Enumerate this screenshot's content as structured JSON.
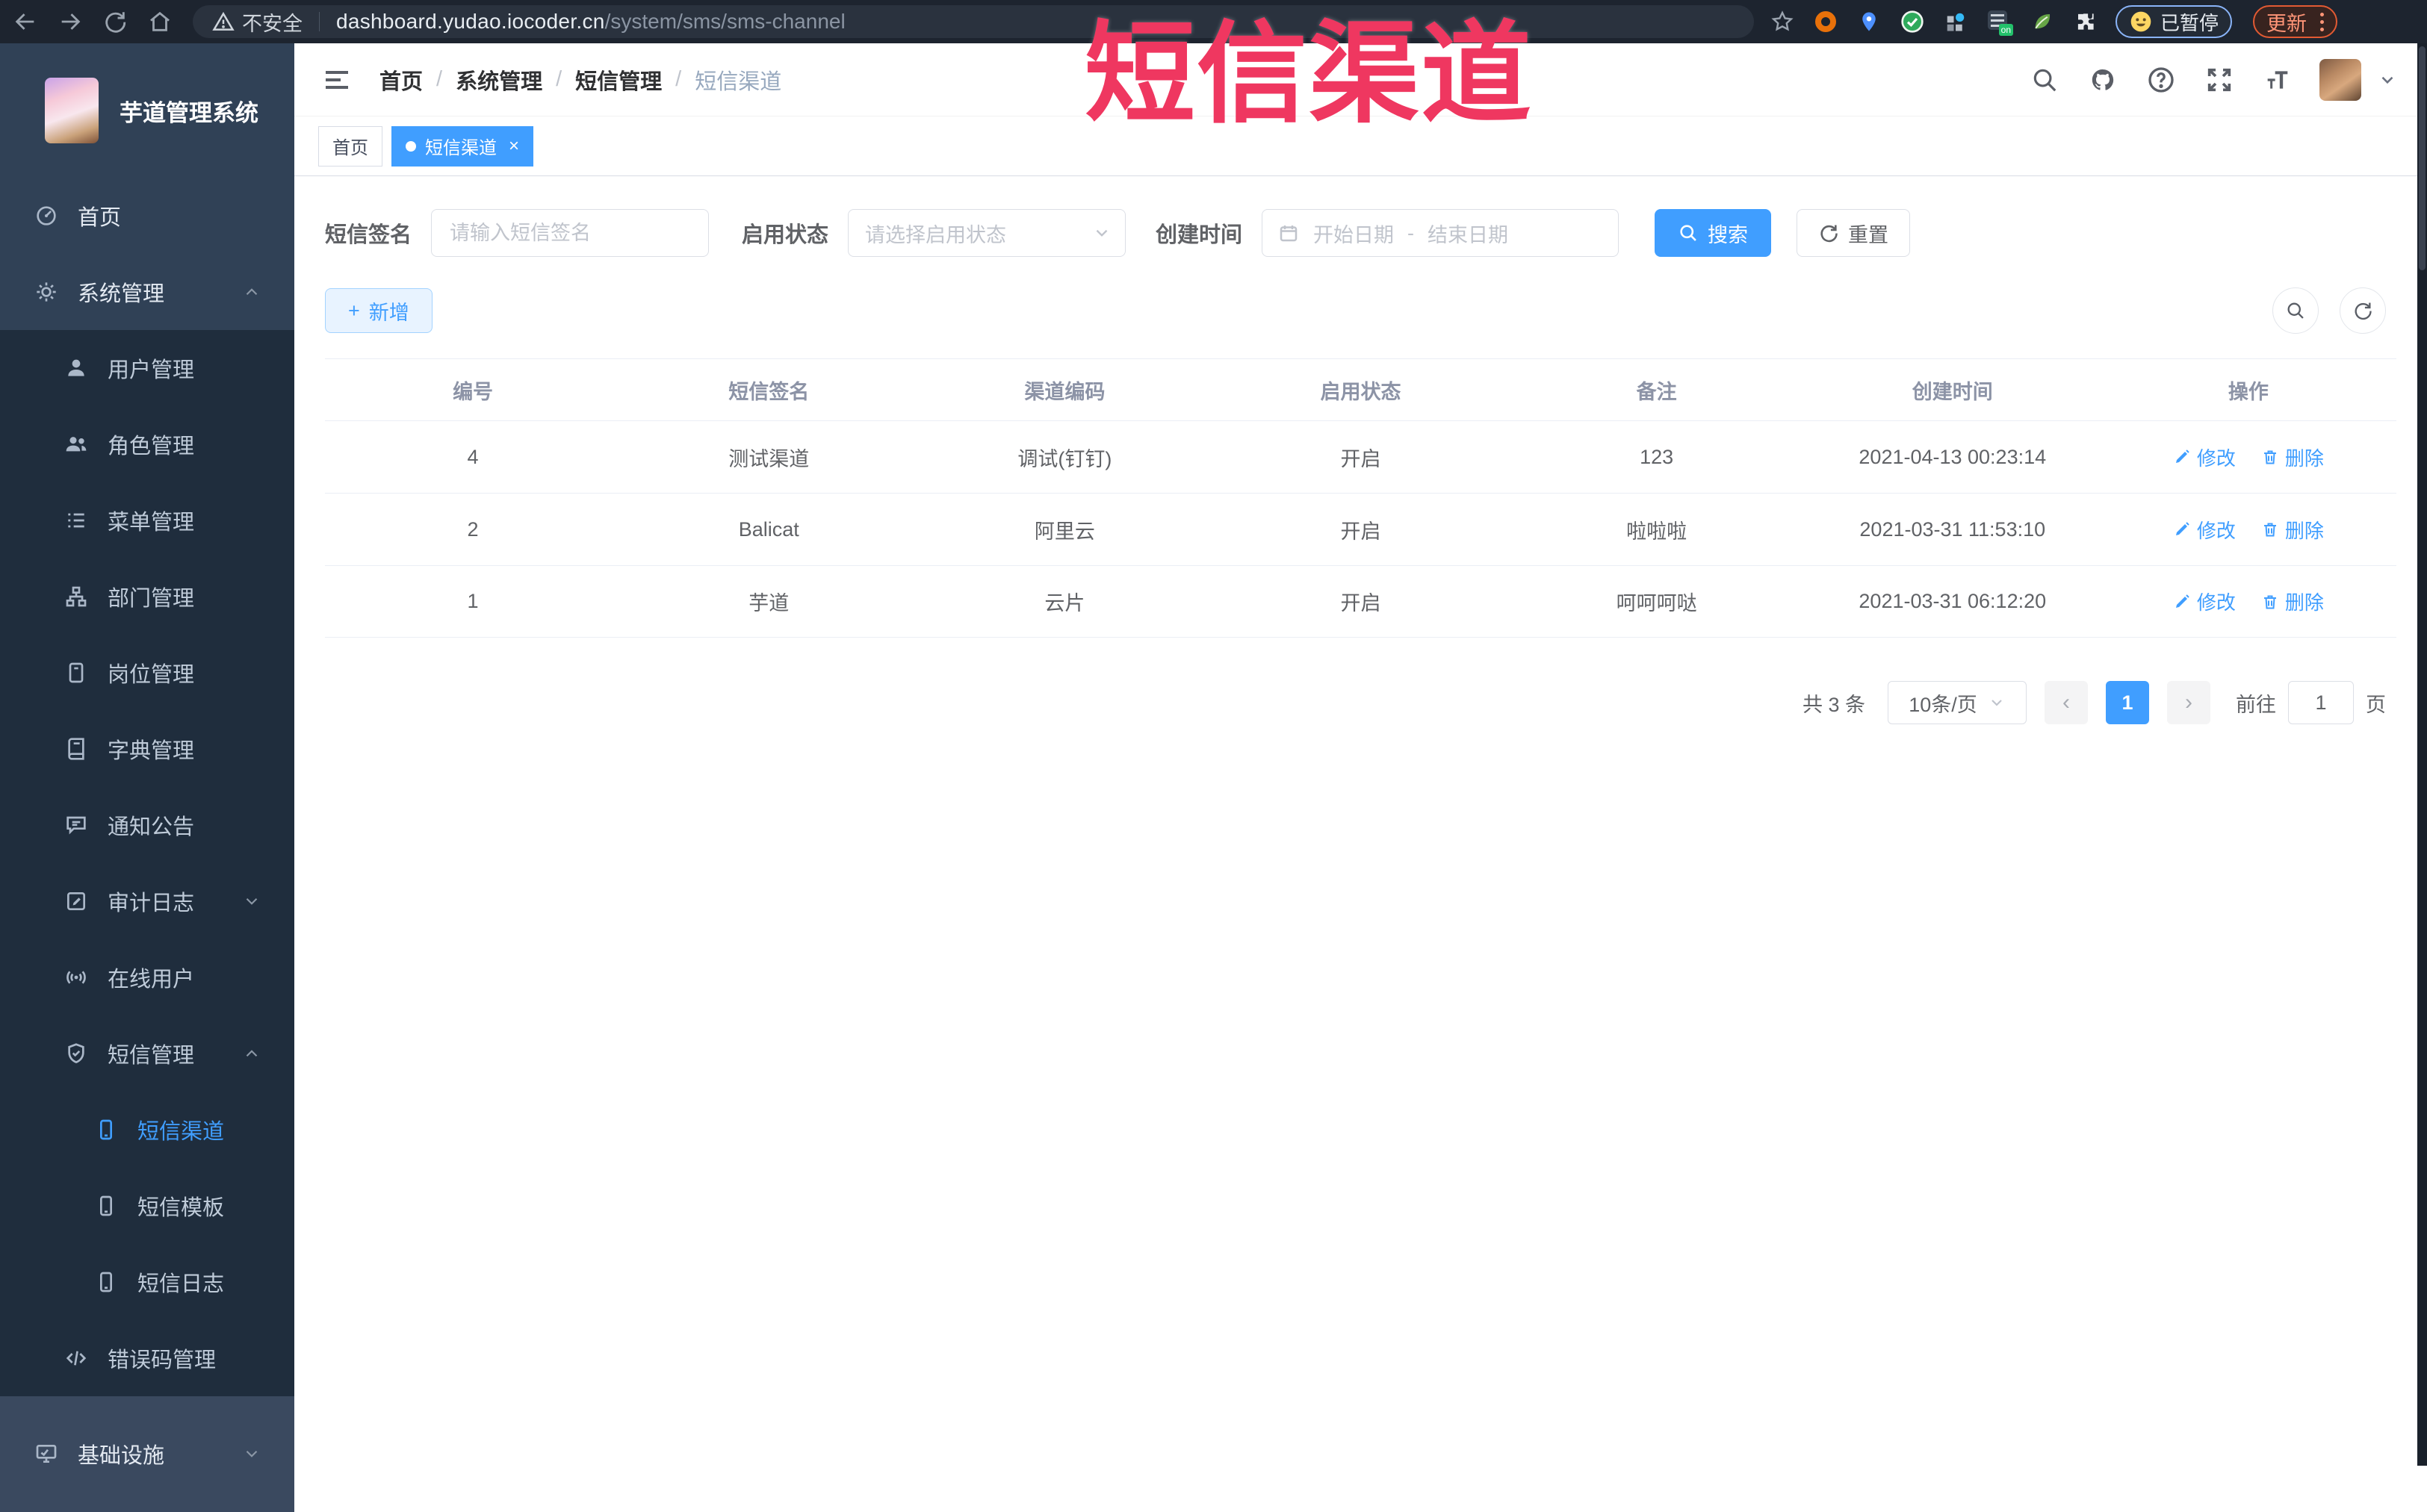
{
  "browser": {
    "security_label": "不安全",
    "url_host": "dashboard.yudao.iocoder.cn",
    "url_path": "/system/sms/sms-channel",
    "paused_badge": "已暂停",
    "update_button": "更新",
    "extensions": [
      {
        "key": "orange-ring",
        "color": "#e8710a"
      },
      {
        "key": "blue-pin",
        "color": "#4d90fe"
      },
      {
        "key": "green-check",
        "color": "#2eaa5c"
      },
      {
        "key": "grid-blue-dot",
        "color": "#35baf6"
      },
      {
        "key": "on-badge",
        "color": "#23c16b",
        "badge": "on"
      },
      {
        "key": "green-leaf",
        "color": "#66a446"
      },
      {
        "key": "puzzle",
        "color": "#e8eaed"
      }
    ]
  },
  "red_overlay_text": "短信渠道",
  "sidebar": {
    "title": "芋道管理系统",
    "items": [
      {
        "key": "home",
        "label": "首页",
        "icon": "dashboard-icon",
        "level": 1
      },
      {
        "key": "system-mgmt",
        "label": "系统管理",
        "icon": "gear-icon",
        "level": 1,
        "chevron": "up"
      },
      {
        "key": "user-mgmt",
        "label": "用户管理",
        "icon": "user-icon",
        "level": 2,
        "sub": true
      },
      {
        "key": "role-mgmt",
        "label": "角色管理",
        "icon": "roles-icon",
        "level": 2,
        "sub": true
      },
      {
        "key": "menu-mgmt",
        "label": "菜单管理",
        "icon": "menu-list-icon",
        "level": 2,
        "sub": true
      },
      {
        "key": "dept-mgmt",
        "label": "部门管理",
        "icon": "org-tree-icon",
        "level": 2,
        "sub": true
      },
      {
        "key": "post-mgmt",
        "label": "岗位管理",
        "icon": "badge-icon",
        "level": 2,
        "sub": true
      },
      {
        "key": "dict-mgmt",
        "label": "字典管理",
        "icon": "dictionary-icon",
        "level": 2,
        "sub": true
      },
      {
        "key": "notice",
        "label": "通知公告",
        "icon": "announcement-icon",
        "level": 2,
        "sub": true
      },
      {
        "key": "audit-log",
        "label": "审计日志",
        "icon": "audit-log-icon",
        "level": 2,
        "sub": true,
        "chevron": "down"
      },
      {
        "key": "online-users",
        "label": "在线用户",
        "icon": "online-users-icon",
        "level": 2,
        "sub": true
      },
      {
        "key": "sms-mgmt",
        "label": "短信管理",
        "icon": "sms-shield-icon",
        "level": 2,
        "sub": true,
        "chevron": "up"
      },
      {
        "key": "sms-channel",
        "label": "短信渠道",
        "icon": "phone-icon",
        "level": 3,
        "sub": true,
        "active": true
      },
      {
        "key": "sms-template",
        "label": "短信模板",
        "icon": "phone-icon",
        "level": 3,
        "sub": true
      },
      {
        "key": "sms-log",
        "label": "短信日志",
        "icon": "phone-icon",
        "level": 3,
        "sub": true
      },
      {
        "key": "error-code-mgmt",
        "label": "错误码管理",
        "icon": "code-icon",
        "level": 2,
        "sub": true
      },
      {
        "key": "infrastructure",
        "label": "基础设施",
        "icon": "monitor-icon",
        "level": 1,
        "chevron": "down",
        "bottom": true
      }
    ]
  },
  "breadcrumb": {
    "items": [
      "首页",
      "系统管理",
      "短信管理",
      "短信渠道"
    ],
    "separator": "/"
  },
  "tabs": [
    {
      "label": "首页",
      "active": false
    },
    {
      "label": "短信渠道",
      "active": true,
      "close": "×"
    }
  ],
  "filters": {
    "sign_label": "短信签名",
    "sign_placeholder": "请输入短信签名",
    "status_label": "启用状态",
    "status_placeholder": "请选择启用状态",
    "time_label": "创建时间",
    "start_placeholder": "开始日期",
    "range_separator": "-",
    "end_placeholder": "结束日期",
    "search_label": "搜索",
    "reset_label": "重置"
  },
  "toolbar": {
    "add_label": "新增",
    "add_plus": "+"
  },
  "table": {
    "columns": [
      "编号",
      "短信签名",
      "渠道编码",
      "启用状态",
      "备注",
      "创建时间",
      "操作"
    ],
    "rows": [
      {
        "id": "4",
        "sign": "测试渠道",
        "code": "调试(钉钉)",
        "status": "开启",
        "remark": "123",
        "created": "2021-04-13 00:23:14"
      },
      {
        "id": "2",
        "sign": "Balicat",
        "code": "阿里云",
        "status": "开启",
        "remark": "啦啦啦",
        "created": "2021-03-31 11:53:10"
      },
      {
        "id": "1",
        "sign": "芋道",
        "code": "云片",
        "status": "开启",
        "remark": "呵呵呵哒",
        "created": "2021-03-31 06:12:20"
      }
    ],
    "edit_label": "修改",
    "delete_label": "删除"
  },
  "pagination": {
    "total_text": "共 3 条",
    "page_size": "10条/页",
    "prev": "‹",
    "next": "›",
    "current_page": "1",
    "goto_label": "前往",
    "goto_value": "1",
    "page_suffix": "页"
  },
  "colors": {
    "accent": "#409eff",
    "sidebar_bg": "#304156",
    "submenu_bg": "#1f2d3d",
    "overlay_red": "#ef3760",
    "browser_bar": "#1d242f"
  }
}
